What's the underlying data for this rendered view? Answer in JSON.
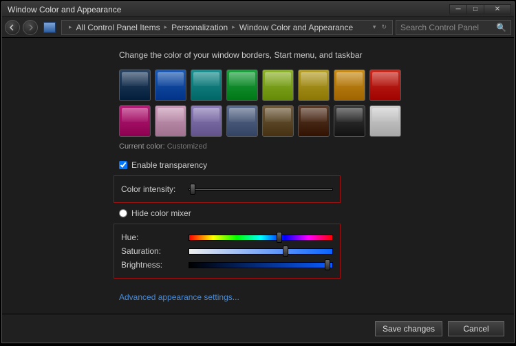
{
  "window": {
    "title": "Window Color and Appearance"
  },
  "breadcrumb": {
    "items": [
      "All Control Panel Items",
      "Personalization",
      "Window Color and Appearance"
    ]
  },
  "search": {
    "placeholder": "Search Control Panel"
  },
  "heading": "Change the color of your window borders, Start menu, and taskbar",
  "swatches": {
    "row1": [
      "#2a4463",
      "#1e5ab0",
      "#1f8e8e",
      "#1f9f3f",
      "#8db32e",
      "#b59f2c",
      "#c78c1a",
      "#c72a1f"
    ],
    "row2": [
      "#b51e78",
      "#c99ab7",
      "#8b7bb5",
      "#5b6b8b",
      "#6e5a3a",
      "#5a3a28",
      "#3a3a3a",
      "#d0d0d0"
    ]
  },
  "currentColor": {
    "label": "Current color:",
    "value": "Customized"
  },
  "transparency": {
    "label": "Enable transparency",
    "checked": true
  },
  "colorIntensity": {
    "label": "Color intensity:",
    "value": 3
  },
  "hideMixer": {
    "label": "Hide color mixer"
  },
  "mixer": {
    "hue": {
      "label": "Hue:",
      "value": 63
    },
    "saturation": {
      "label": "Saturation:",
      "value": 67
    },
    "brightness": {
      "label": "Brightness:",
      "value": 96
    }
  },
  "advancedLink": "Advanced appearance settings...",
  "footer": {
    "save": "Save changes",
    "cancel": "Cancel"
  }
}
